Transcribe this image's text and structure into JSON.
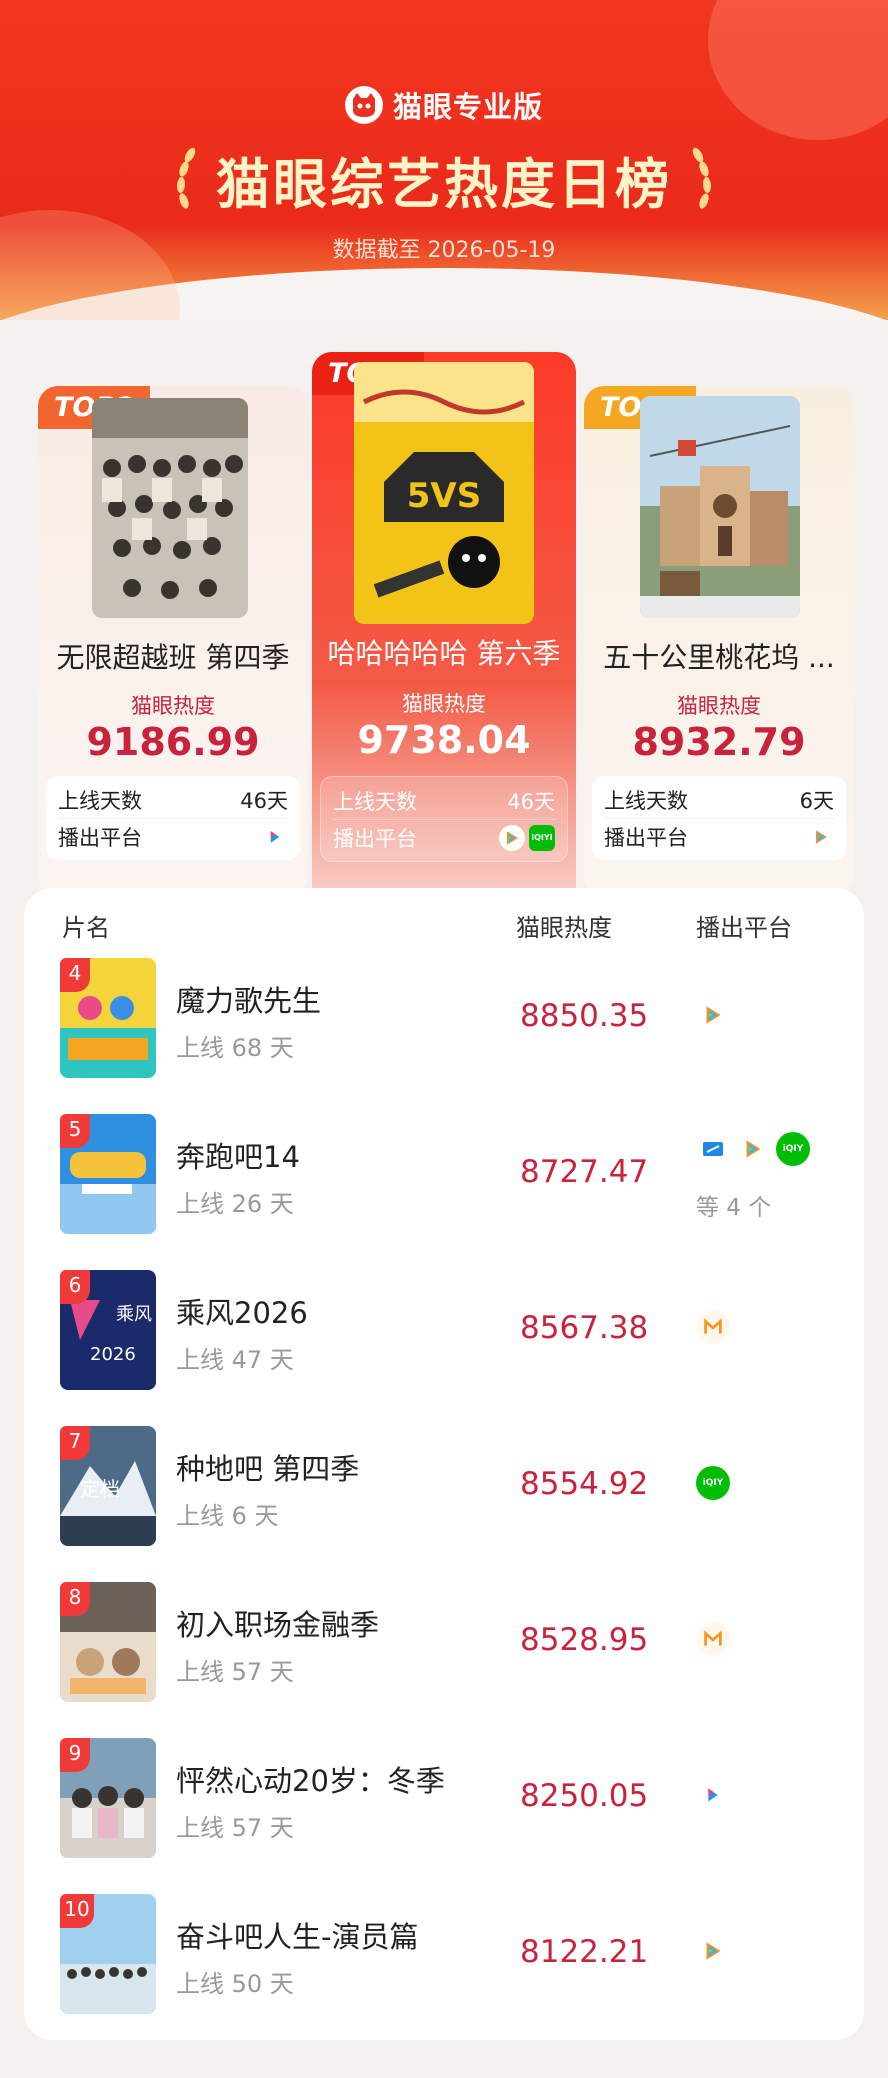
{
  "header": {
    "brand": "猫眼专业版",
    "title": "猫眼综艺热度日榜",
    "date_line": "数据截至 2026-05-19"
  },
  "top": [
    {
      "badge": "TOP2",
      "title": "无限超越班 第四季",
      "heat_label": "猫眼热度",
      "heat": "9186.99",
      "days_label": "上线天数",
      "days": "46天",
      "platform_label": "播出平台",
      "platforms": [
        "youku-icon"
      ]
    },
    {
      "badge": "TOP1",
      "title": "哈哈哈哈哈 第六季",
      "heat_label": "猫眼热度",
      "heat": "9738.04",
      "days_label": "上线天数",
      "days": "46天",
      "platform_label": "播出平台",
      "platforms": [
        "tencent-video-icon",
        "iqiyi-icon"
      ]
    },
    {
      "badge": "TOP3",
      "title": "五十公里桃花坞 ...",
      "heat_label": "猫眼热度",
      "heat": "8932.79",
      "days_label": "上线天数",
      "days": "6天",
      "platform_label": "播出平台",
      "platforms": [
        "tencent-video-icon"
      ]
    }
  ],
  "list": {
    "headers": {
      "name": "片名",
      "heat": "猫眼热度",
      "platform": "播出平台"
    },
    "rows": [
      {
        "rank": "4",
        "title": "魔力歌先生",
        "days": "上线 68 天",
        "heat": "8850.35",
        "platforms": [
          "tencent-video-icon"
        ],
        "more": ""
      },
      {
        "rank": "5",
        "title": "奔跑吧14",
        "days": "上线 26 天",
        "heat": "8727.47",
        "platforms": [
          "zhejiang-tv-icon",
          "tencent-video-icon",
          "iqiyi-icon"
        ],
        "more": "等 4 个"
      },
      {
        "rank": "6",
        "title": "乘风2026",
        "days": "上线 47 天",
        "heat": "8567.38",
        "platforms": [
          "mango-tv-icon"
        ],
        "more": ""
      },
      {
        "rank": "7",
        "title": "种地吧 第四季",
        "days": "上线 6 天",
        "heat": "8554.92",
        "platforms": [
          "iqiyi-icon"
        ],
        "more": ""
      },
      {
        "rank": "8",
        "title": "初入职场金融季",
        "days": "上线 57 天",
        "heat": "8528.95",
        "platforms": [
          "mango-tv-icon"
        ],
        "more": ""
      },
      {
        "rank": "9",
        "title": "怦然心动20岁：冬季",
        "days": "上线 57 天",
        "heat": "8250.05",
        "platforms": [
          "youku-icon"
        ],
        "more": ""
      },
      {
        "rank": "10",
        "title": "奋斗吧人生-演员篇",
        "days": "上线 50 天",
        "heat": "8122.21",
        "platforms": [
          "tencent-video-icon"
        ],
        "more": ""
      }
    ]
  },
  "colors": {
    "accent": "#ea2a1a",
    "heat": "#c9233c"
  }
}
